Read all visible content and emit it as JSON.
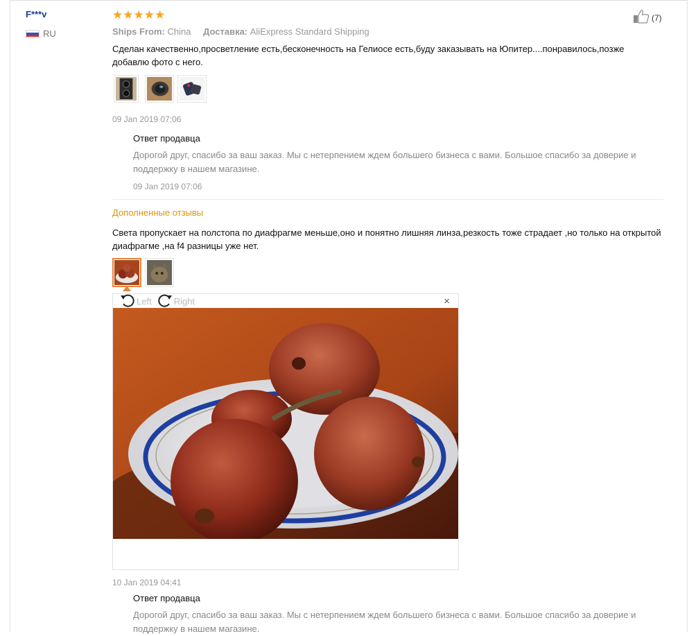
{
  "review": {
    "user": "F***v",
    "country": "RU",
    "stars": "★★★★★",
    "rating": 5,
    "likes": "(7)",
    "ships_from_label": "Ships From:",
    "ships_from_value": "China",
    "delivery_label": "Доставка:",
    "delivery_value": "AliExpress Standard Shipping",
    "text": "Сделан качественно,просветление есть,бесконечность на Гелиосе есть,буду заказывать на Юпитер....понравилось,позже добавлю фото с него.",
    "date": "09 Jan 2019 07:06",
    "seller_reply": {
      "title": "Ответ продавца",
      "text": "Дорогой друг, спасибо за ваш заказ. Мы с нетерпением ждем большего бизнеса с вами. Большое спасибо за доверие и поддержку в нашем магазине.",
      "date": "09 Jan 2019 07:06"
    }
  },
  "additional": {
    "heading": "Дополненные отзывы",
    "text": "Света пропускает на полстопа по диафрагме меньше,оно и понятно лишняя линза,резкость тоже страдает ,но только на открытой диафрагме ,на f4 разницы уже нет.",
    "viewer": {
      "left_label": "Left",
      "right_label": "Right",
      "close": "×"
    },
    "date": "10 Jan 2019 04:41",
    "seller_reply": {
      "title": "Ответ продавца",
      "text": "Дорогой друг, спасибо за ваш заказ. Мы с нетерпением ждем большего бизнеса с вами. Большое спасибо за доверие и поддержку в нашем магазине."
    }
  },
  "colors": {
    "star": "#f5a623",
    "user": "#1a3e8c",
    "additional_heading": "#d9960a",
    "muted": "#999999"
  }
}
